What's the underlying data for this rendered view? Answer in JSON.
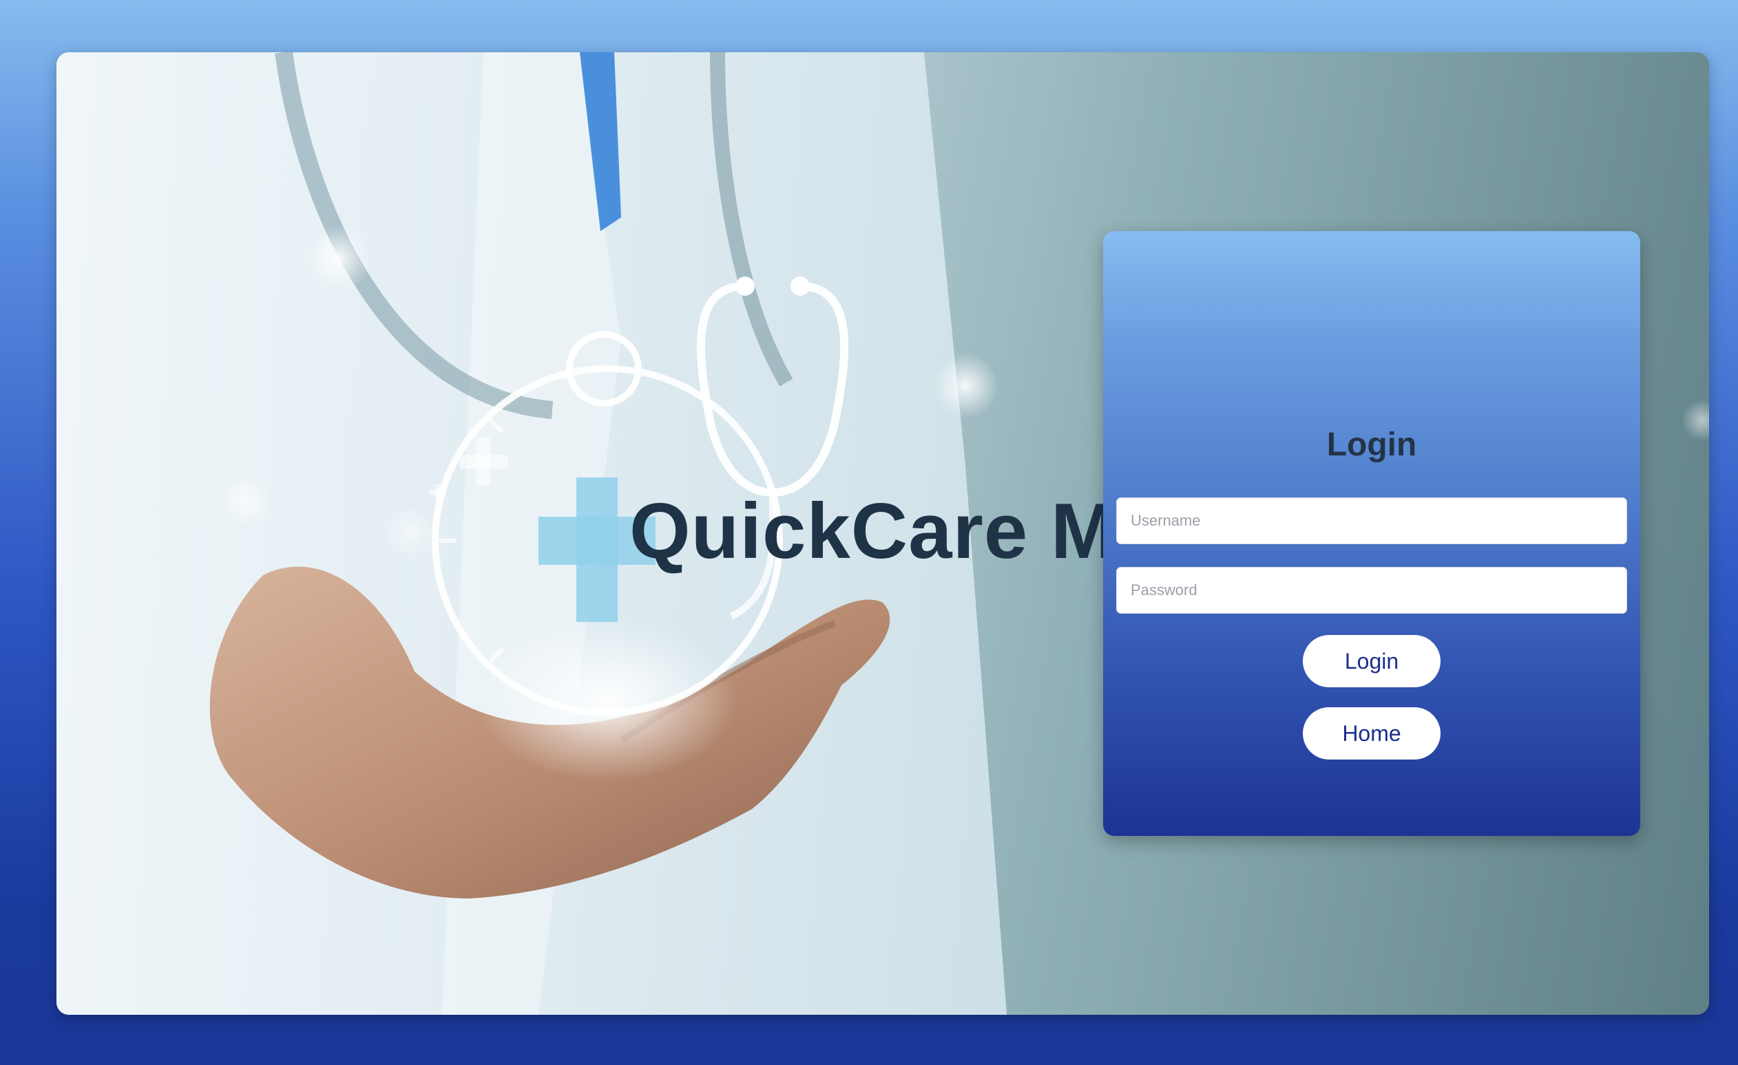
{
  "brand": {
    "title": "QuickCare Md"
  },
  "login": {
    "heading": "Login",
    "username_placeholder": "Username",
    "password_placeholder": "Password",
    "login_label": "Login",
    "home_label": "Home"
  },
  "colors": {
    "page_gradient_top": "#86bbee",
    "page_gradient_bottom": "#193797",
    "panel_gradient_top": "#86bdf1",
    "panel_gradient_bottom": "#1c3494",
    "title_color": "#1f3347",
    "button_text": "#1c2e8c"
  },
  "icons": {
    "hero_image": "doctor-hand-stethoscope-medical-cross-illustration"
  }
}
